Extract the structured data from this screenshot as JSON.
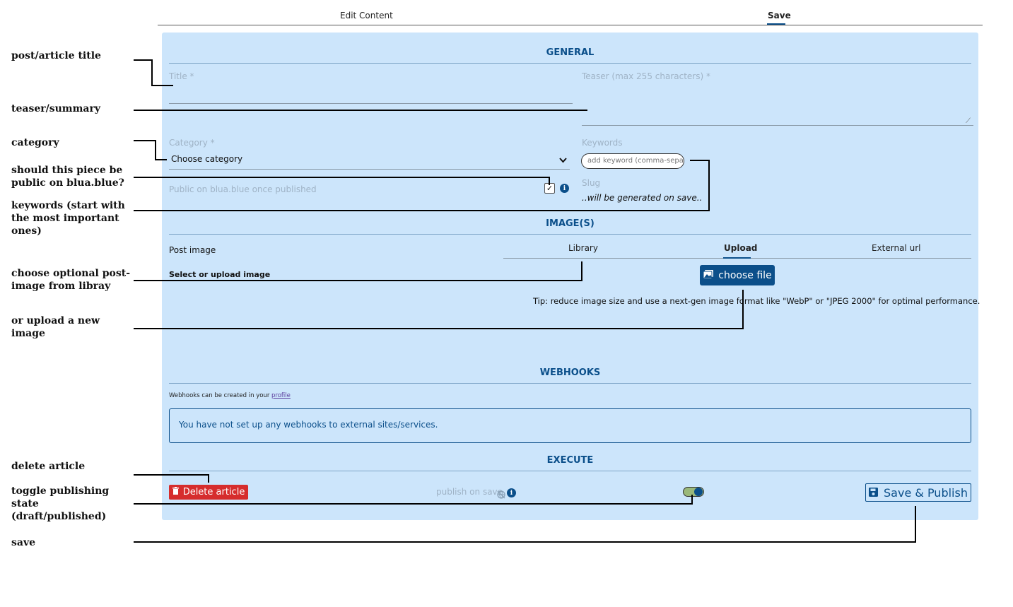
{
  "top_tabs": {
    "edit": "Edit Content",
    "save": "Save"
  },
  "general": {
    "heading": "GENERAL",
    "title_label": "Title *",
    "teaser_label": "Teaser (max 255 characters) *",
    "category_label": "Category *",
    "category_value": "Choose category",
    "keywords_label": "Keywords",
    "keywords_placeholder": "add keyword (comma-separated)",
    "public_label": "Public on blua.blue once published",
    "public_checked": true,
    "slug_label": "Slug",
    "slug_value": "..will be generated on save.."
  },
  "images": {
    "heading": "IMAGE(S)",
    "post_image_label": "Post image",
    "select_label": "Select or upload image",
    "tabs": [
      "Library",
      "Upload",
      "External url"
    ],
    "active_tab": "Upload",
    "choose_file": "choose file",
    "tip": "Tip: reduce image size and use a next-gen image format like \"WebP\" or \"JPEG 2000\" for optimal performance."
  },
  "webhooks": {
    "heading": "WEBHOOKS",
    "note_prefix": "Webhooks can be created in your",
    "note_link": "profile",
    "empty_message": "You have not set up any webhooks to external sites/services."
  },
  "execute": {
    "heading": "EXECUTE",
    "delete_label": "Delete article",
    "publish_on_save": "publish on save",
    "publish_toggle": true,
    "save_label": "Save & Publish"
  },
  "annotations": [
    "post/article title",
    "teaser/summary",
    "category",
    "should this piece be public on blua.blue?",
    "keywords (start with the most important ones)",
    "choose optional post-image from libray",
    "or upload a new image",
    "delete article",
    "toggle publishing state (draft/published)",
    "save"
  ],
  "colors": {
    "accent": "#0b4f8a",
    "panel": "#cce5fb",
    "danger": "#d62d2d"
  }
}
